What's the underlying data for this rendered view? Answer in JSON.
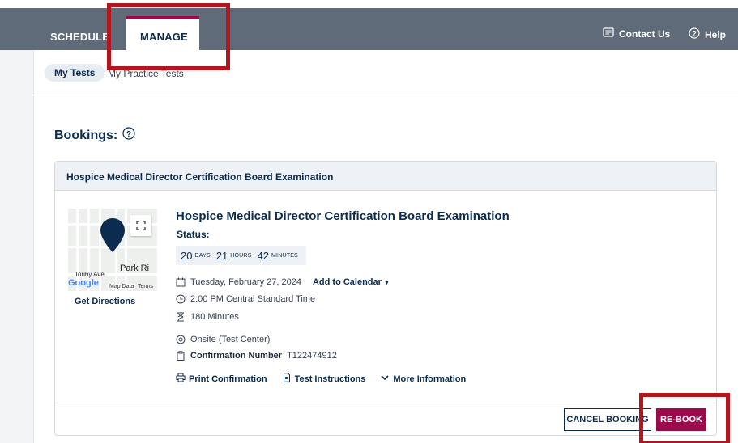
{
  "header": {
    "tabs": [
      {
        "label": "SCHEDULE"
      },
      {
        "label": "MANAGE"
      }
    ],
    "contact_label": "Contact Us",
    "help_label": "Help"
  },
  "subnav": {
    "tabs": [
      {
        "label": "My Tests"
      },
      {
        "label": "My Practice Tests"
      }
    ]
  },
  "bookings": {
    "title": "Bookings:"
  },
  "booking": {
    "header_title": "Hospice Medical Director Certification Board Examination",
    "exam_title": "Hospice Medical Director Certification Board Examination",
    "status_label": "Status:",
    "countdown": {
      "days": "20",
      "days_unit": "DAYS",
      "hours": "21",
      "hours_unit": "HOURS",
      "minutes": "42",
      "minutes_unit": "MINUTES"
    },
    "date": "Tuesday, February 27, 2024",
    "add_to_calendar": "Add to Calendar",
    "time": "2:00 PM Central Standard Time",
    "duration": "180 Minutes",
    "location": "Onsite (Test Center)",
    "confirmation_label": "Confirmation Number",
    "confirmation_number": "T122474912",
    "links": {
      "print": "Print Confirmation",
      "instructions": "Test Instructions",
      "more": "More Information"
    },
    "map": {
      "park_label": "Park Ri",
      "road_label": "Touhy Ave",
      "map_data": "Map Data",
      "terms": "Terms",
      "google": "Google"
    },
    "directions": "Get Directions",
    "cancel_label": "CANCEL BOOKING",
    "rebook_label": "RE-BOOK"
  },
  "colors": {
    "accent": "#9b0a4b",
    "header_bg": "#5f6b78",
    "navy": "#0b2b4f",
    "highlight": "#b2151b"
  }
}
